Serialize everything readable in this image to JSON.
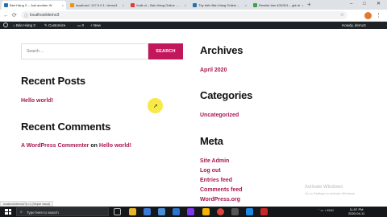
{
  "browser": {
    "tabs": [
      {
        "title": "Bán Hàng 3 – Just another W",
        "active": true,
        "favicon_color": "#2271b1"
      },
      {
        "title": "localhost / 127.0.0.1 / demo3",
        "active": false,
        "favicon_color": "#f29111"
      },
      {
        "title": "Xuất ơi – Bán Hàng Online - ...",
        "active": false,
        "favicon_color": "#e53935"
      },
      {
        "title": "Tủy biến Bán Hàng Online ...",
        "active": false,
        "favicon_color": "#2271b1"
      },
      {
        "title": "Rewrite làm 400/301 – giá rẻ",
        "active": false,
        "favicon_color": "#43a047"
      }
    ],
    "new_tab": "+",
    "url": "localhost/demo3",
    "tab_close": "×",
    "window_controls": {
      "minimize": "–",
      "maximize": "□",
      "close": "✕"
    }
  },
  "admin_bar": {
    "site_name": "Bán Hàng 3",
    "customize": "Customize",
    "comments_count": "0",
    "new": "+ New",
    "howdy": "Howdy, demo3"
  },
  "search": {
    "placeholder": "Search ...",
    "button": "SEARCH"
  },
  "recent_posts": {
    "heading": "Recent Posts",
    "items": [
      "Hello world!"
    ]
  },
  "recent_comments": {
    "heading": "Recent Comments",
    "author": "A WordPress Commenter",
    "connector": "on",
    "post": "Hello world!"
  },
  "archives": {
    "heading": "Archives",
    "items": [
      "April 2020"
    ]
  },
  "categories": {
    "heading": "Categories",
    "items": [
      "Uncategorized"
    ]
  },
  "meta": {
    "heading": "Meta",
    "items": [
      "Site Admin",
      "Log out",
      "Entries feed",
      "Comments feed",
      "WordPress.org"
    ]
  },
  "status_bar": "localhost/demo3/?p=1 (Simple visual)",
  "activation": {
    "title": "Activate Windows",
    "subtitle": "Go to Settings to activate Windows."
  },
  "taskbar": {
    "search_placeholder": "Type here to search",
    "time": "11:57 PM",
    "date": "2020-04-11",
    "tray_icons": "ˆ  ▭  ♪  ENG"
  },
  "colors": {
    "accent": "#c2185b",
    "link": "#a8164f",
    "admin_bar": "#1d2327",
    "taskbar": "#15171a"
  }
}
